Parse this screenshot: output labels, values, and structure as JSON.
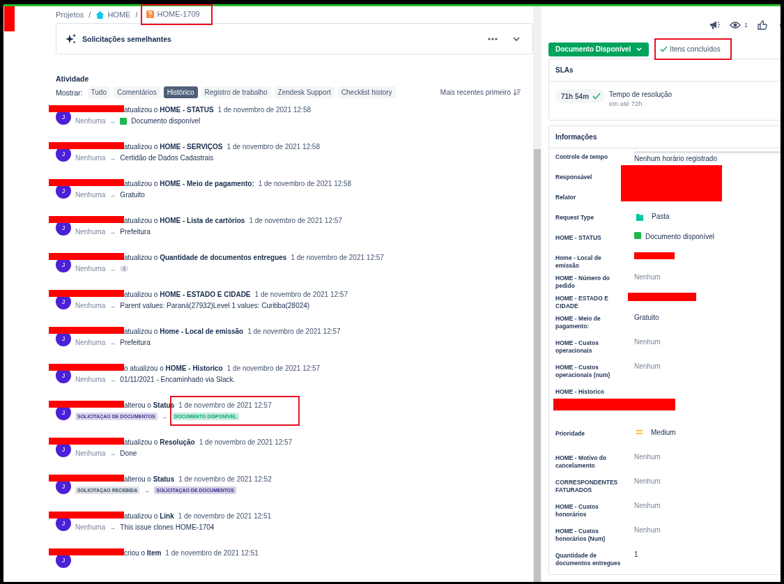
{
  "breadcrumb": {
    "items": [
      {
        "kind": "link",
        "label": "Projetos",
        "highlighted": false
      },
      {
        "kind": "separator",
        "label": "/"
      },
      {
        "kind": "project",
        "label": "HOME",
        "highlighted": false
      },
      {
        "kind": "separator",
        "label": "/"
      },
      {
        "kind": "issue",
        "label": "HOME-1709",
        "highlighted": true
      }
    ]
  },
  "similar": {
    "title": "Solicitações semelhantes"
  },
  "activity": {
    "title": "Atividade",
    "show_label": "Mostrar:",
    "filters": [
      {
        "label": "Tudo",
        "selected": false
      },
      {
        "label": "Comentários",
        "selected": false
      },
      {
        "label": "Histórico",
        "selected": true
      },
      {
        "label": "Registro de trabalho",
        "selected": false
      },
      {
        "label": "Zendesk Support",
        "selected": false
      },
      {
        "label": "Checklist history",
        "selected": false
      }
    ],
    "sort": "Mais recentes primeiro",
    "entries": [
      {
        "initial": "J",
        "verb": "atualizou o",
        "field": "HOME - STATUS",
        "date": "1 de novembro de 2021 12:58",
        "kind": "swatch",
        "from": "Nenhuma",
        "arrow": "→",
        "to": "Documento disponível",
        "color": "#1fb84f",
        "highlighted": false
      },
      {
        "initial": "J",
        "verb": "atualizou o",
        "field": "HOME - SERVIÇOS",
        "date": "1 de novembro de 2021 12:58",
        "kind": "text",
        "from": "Nenhuma",
        "arrow": "→",
        "to": "Certidão de Dados Cadastrais",
        "highlighted": false
      },
      {
        "initial": "J",
        "verb": "atualizou o",
        "field": "HOME - Meio de pagamento:",
        "date": "1 de novembro de 2021 12:58",
        "kind": "text",
        "from": "Nenhuma",
        "arrow": "→",
        "to": "Gratuito",
        "highlighted": false
      },
      {
        "initial": "J",
        "verb": "atualizou o",
        "field": "HOME - Lista de cartórios",
        "date": "1 de novembro de 2021 12:57",
        "kind": "text",
        "from": "Nenhuma",
        "arrow": "→",
        "to": "Prefeitura",
        "highlighted": false
      },
      {
        "initial": "J",
        "verb": "atualizou o",
        "field": "Quantidade de documentos entregues",
        "date": "1 de novembro de 2021 12:57",
        "kind": "count",
        "from": "Nenhuma",
        "arrow": "→",
        "to": "1",
        "highlighted": false
      },
      {
        "initial": "J",
        "verb": "atualizou o",
        "field": "HOME - ESTADO E CIDADE",
        "date": "1 de novembro de 2021 12:57",
        "kind": "text",
        "from": "Nenhuma",
        "arrow": "→",
        "to": "Parent values: Paraná(27932)Level 1 values: Curitiba(28024)",
        "highlighted": false
      },
      {
        "initial": "J",
        "verb": "atualizou o",
        "field": "Home - Local de emissão",
        "date": "1 de novembro de 2021 12:57",
        "kind": "text",
        "from": "Nenhuma",
        "arrow": "→",
        "to": "Prefeitura",
        "highlighted": false
      },
      {
        "initial": "J",
        "verb": "o atualizou o",
        "field": "HOME - Historico",
        "date": "1 de novembro de 2021 12:57",
        "kind": "text",
        "from": "Nenhuma",
        "arrow": "→",
        "to": "01/11/2021 - Encaminhado via Slack.",
        "highlighted": false
      },
      {
        "initial": "J",
        "verb": "alterou o",
        "field": "Status",
        "date": "1 de novembro de 2021 12:57",
        "kind": "status",
        "from": {
          "label": "SOLICITAÇAO DE DOCUMENTOS",
          "color": "#403294"
        },
        "arrow": "→",
        "to": {
          "label": "DOCUMENTO DISPONÍVEL",
          "color": "#00a86b"
        },
        "highlighted": true
      },
      {
        "initial": "J",
        "verb": "atualizou o",
        "field": "Resolução",
        "date": "1 de novembro de 2021 12:57",
        "kind": "text",
        "from": "Nenhuma",
        "arrow": "→",
        "to": "Done",
        "highlighted": false
      },
      {
        "initial": "J",
        "verb": "alterou o",
        "field": "Status",
        "date": "1 de novembro de 2021 12:52",
        "kind": "status",
        "from": {
          "label": "SOLICITAÇAO RECEBIDA",
          "color": "#42526e"
        },
        "arrow": "→",
        "to": {
          "label": "SOLICITAÇAO DE DOCUMENTOS",
          "color": "#403294"
        },
        "highlighted": false
      },
      {
        "initial": "J",
        "verb": "atualizou o",
        "field": "Link",
        "date": "1 de novembro de 2021 12:51",
        "kind": "text",
        "from": "Nenhuma",
        "arrow": "→",
        "to": "This issue clones HOME-1704",
        "highlighted": false
      },
      {
        "initial": "J",
        "verb": "criou o",
        "field": "Item",
        "date": "1 de novembro de 2021 12:51",
        "kind": "none",
        "highlighted": false
      }
    ]
  },
  "header": {
    "watchers": "1"
  },
  "status_button": {
    "label": "Documento Disponível"
  },
  "checklist": {
    "label": "Itens concluídos",
    "highlighted": true
  },
  "slas": {
    "title": "SLAs",
    "time": "71h 54m",
    "name": "Tempo de resolução",
    "goal": "em até 72h"
  },
  "details": {
    "title": "Informações",
    "fields": [
      {
        "label": "Controle de tempo",
        "kind": "tracking",
        "value": "Nenhum horário registrado",
        "level": 0
      },
      {
        "label": "Responsável",
        "kind": "redacted-tall"
      },
      {
        "label": "Relator",
        "kind": "empty"
      },
      {
        "label": "Request Type",
        "kind": "request",
        "value": "Pasta",
        "color": "#00c7a0"
      },
      {
        "label": "HOME - STATUS",
        "kind": "swatch",
        "value": "Documento disponível",
        "color": "#1fb84f"
      },
      {
        "label": "Home - Local de emissão",
        "kind": "redacted"
      },
      {
        "label": "HOME - Número do pedido",
        "kind": "muted",
        "value": "Nenhum"
      },
      {
        "label": "HOME - ESTADO E CIDADE",
        "kind": "redacted"
      },
      {
        "label": "HOME - Meio de pagamento:",
        "kind": "text",
        "value": "Gratuito"
      },
      {
        "label": "HOME - Custos operacionais",
        "kind": "muted",
        "value": "Nenhum"
      },
      {
        "label": "HOME - Custos operacionais (num)",
        "kind": "muted",
        "value": "Nenhum"
      },
      {
        "label": "HOME - Historico",
        "kind": "block-redacted"
      },
      {
        "label": "Prioridade",
        "kind": "priority",
        "value": "Medium"
      },
      {
        "label": "HOME - Motivo do cancelamento",
        "kind": "muted",
        "value": "Nenhum"
      },
      {
        "label": "CORRESPONDENTES FATURADOS",
        "kind": "muted",
        "value": "Nenhum"
      },
      {
        "label": "HOME - Custos honorários",
        "kind": "muted",
        "value": "Nenhum"
      },
      {
        "label": "HOME - Custos honorários (Num)",
        "kind": "muted",
        "value": "Nenhum"
      },
      {
        "label": "Quantidade de documentos entregues",
        "kind": "text",
        "value": "1"
      }
    ]
  }
}
